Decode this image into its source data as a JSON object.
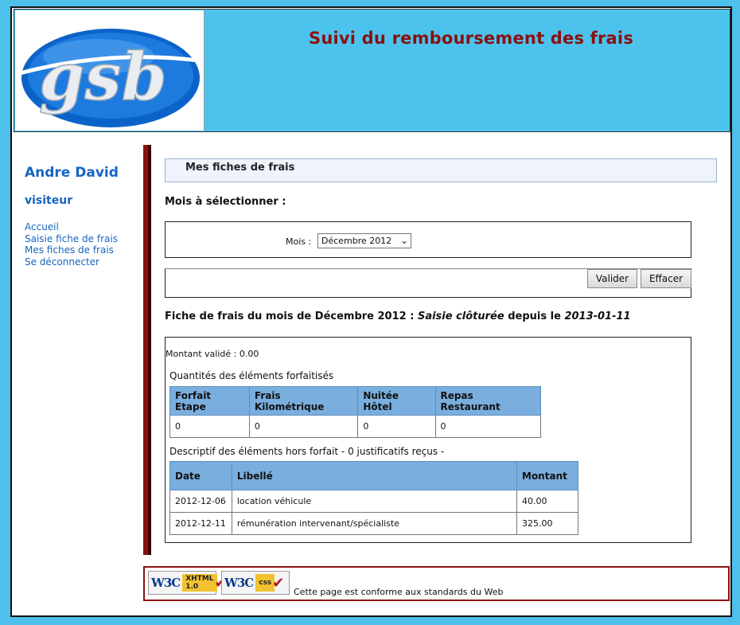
{
  "header": {
    "logo_text": "gsb",
    "title": "Suivi du remboursement des frais"
  },
  "sidebar": {
    "user_name": "Andre David",
    "role": "visiteur",
    "menu": [
      {
        "label": "Accueil"
      },
      {
        "label": "Saisie fiche de frais"
      },
      {
        "label": "Mes fiches de frais"
      },
      {
        "label": "Se déconnecter"
      }
    ]
  },
  "main": {
    "section_title": "Mes fiches de frais",
    "select_prompt": "Mois à sélectionner :",
    "form": {
      "mois_label": "Mois :",
      "mois_selected": "Décembre 2012",
      "valider_label": "Valider",
      "effacer_label": "Effacer"
    },
    "fiche": {
      "heading_prefix": "Fiche de frais du mois de Décembre 2012 : ",
      "etat": "Saisie clôturée",
      "heading_mid": " depuis le ",
      "date_modif": "2013-01-11",
      "montant_valide": "Montant validé : 0.00",
      "forfait_caption": "Quantités des éléments forfaitisés",
      "forfait_headers": [
        "Forfait Etape",
        "Frais Kilométrique",
        "Nuitée Hôtel",
        "Repas Restaurant"
      ],
      "forfait_values": [
        "0",
        "0",
        "0",
        "0"
      ],
      "hors_caption": "Descriptif des éléments hors forfait - 0 justificatifs reçus -",
      "hors_headers": [
        "Date",
        "Libellé",
        "Montant"
      ],
      "hors_rows": [
        [
          "2012-12-06",
          "location véhicule",
          "40.00"
        ],
        [
          "2012-12-11",
          "rémunération intervenant/spécialiste",
          "325.00"
        ]
      ]
    }
  },
  "footer": {
    "badge_xhtml_w3c": "W3C",
    "badge_xhtml_tag_1": "XHTML",
    "badge_xhtml_tag_2": "1.0",
    "badge_css_w3c": "W3C",
    "badge_css_tag": "css",
    "conformance_text": "Cette page est conforme aux standards du Web"
  },
  "colors": {
    "frame_blue": "#4dc0eb",
    "title_red": "#8a1010",
    "link_blue": "#1565c0",
    "table_header": "#7aaede"
  }
}
